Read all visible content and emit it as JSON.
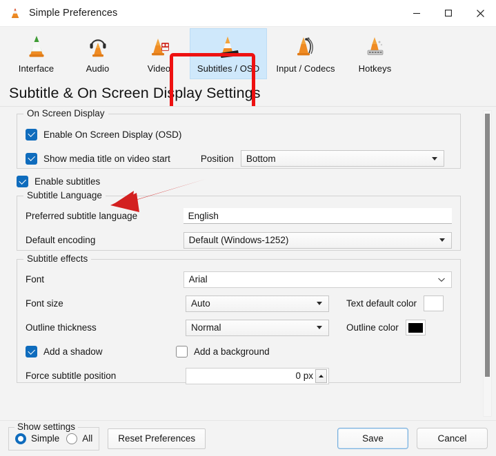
{
  "window": {
    "title": "Simple Preferences",
    "app_icon": "vlc-cone-icon",
    "controls": {
      "minimize": "minimize-icon",
      "maximize": "maximize-icon",
      "close": "close-icon"
    }
  },
  "toolbar": {
    "items": [
      {
        "label": "Interface",
        "icon": "vlc-cone-green-icon",
        "selected": false
      },
      {
        "label": "Audio",
        "icon": "vlc-cone-headphones-icon",
        "selected": false
      },
      {
        "label": "Video",
        "icon": "vlc-cone-film-icon",
        "selected": false
      },
      {
        "label": "Subtitles / OSD",
        "icon": "vlc-cone-subtitles-icon",
        "selected": true
      },
      {
        "label": "Input / Codecs",
        "icon": "vlc-cone-cables-icon",
        "selected": false
      },
      {
        "label": "Hotkeys",
        "icon": "vlc-cone-keyboard-icon",
        "selected": false
      }
    ]
  },
  "page": {
    "heading": "Subtitle & On Screen Display Settings"
  },
  "osd_group": {
    "title": "On Screen Display",
    "enable_osd": {
      "label": "Enable On Screen Display (OSD)",
      "checked": true
    },
    "show_title": {
      "label": "Show media title on video start",
      "checked": true
    },
    "position": {
      "label": "Position",
      "value": "Bottom"
    }
  },
  "enable_subtitles": {
    "label": "Enable subtitles",
    "checked": true
  },
  "language_group": {
    "title": "Subtitle Language",
    "preferred": {
      "label": "Preferred subtitle language",
      "value": "English"
    },
    "encoding": {
      "label": "Default encoding",
      "value": "Default (Windows-1252)"
    }
  },
  "effects_group": {
    "title": "Subtitle effects",
    "font": {
      "label": "Font",
      "value": "Arial"
    },
    "font_size": {
      "label": "Font size",
      "value": "Auto"
    },
    "text_default_color": {
      "label": "Text default color",
      "color": "#ffffff"
    },
    "outline_thickness": {
      "label": "Outline thickness",
      "value": "Normal"
    },
    "outline_color": {
      "label": "Outline color",
      "color": "#000000"
    },
    "add_shadow": {
      "label": "Add a shadow",
      "checked": true
    },
    "add_background": {
      "label": "Add a background",
      "checked": false
    },
    "force_position": {
      "label": "Force subtitle position",
      "value": "0 px"
    }
  },
  "bottom": {
    "show_settings_title": "Show settings",
    "simple_label": "Simple",
    "all_label": "All",
    "simple_selected": true,
    "reset_label": "Reset Preferences",
    "save_label": "Save",
    "cancel_label": "Cancel"
  },
  "annotations": {
    "highlight_color": "#ee1111",
    "arrow_color": "#d32020",
    "highlighted_tab": "Subtitles / OSD",
    "arrow_target": "Enable subtitles"
  },
  "colors": {
    "accent": "#0f6cbd",
    "selected_tab_bg": "#cfe8fb",
    "window_bg": "#f3f3f3"
  }
}
